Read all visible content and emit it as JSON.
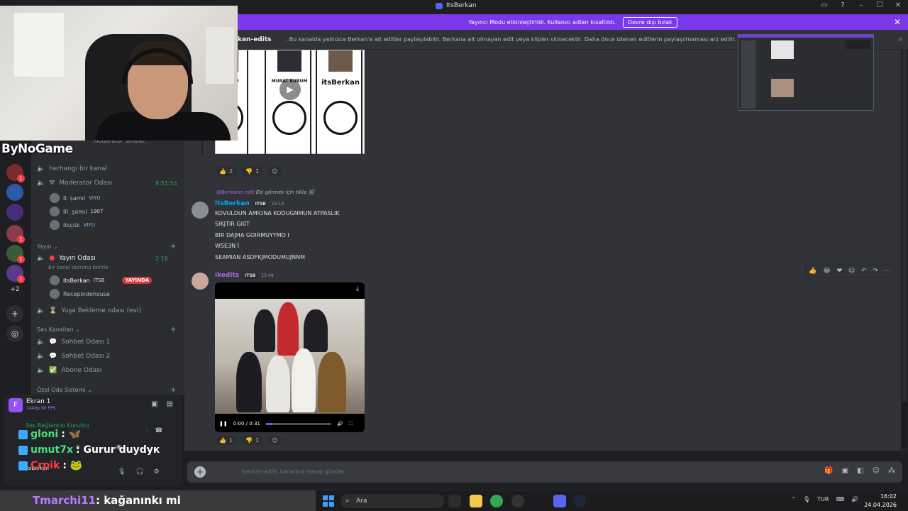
{
  "window": {
    "title": "ItsBerkan"
  },
  "banner": {
    "text": "Yayıncı Modu etkinleştirildi. Kullanıcı adları kısaltıldı.",
    "button": "Devre dışı bırak"
  },
  "header": {
    "channel": "kan-edits",
    "topic": ". Bu kanalda yalnızca Berkan'a ait editler paylaşılabilir. Berkana ait olmayan edit veya klipler silinecektir. Daha önce izlenen editlerin paylaşılmaması arz edilir."
  },
  "watermark": "ByNoGame",
  "servers": {
    "more": "+2",
    "badges": [
      "1",
      "1",
      "1",
      "1"
    ]
  },
  "sidebar": {
    "top_cut": "Moderator Sohbet",
    "channels": {
      "herhangi": "herhangi bir kanal",
      "moderator": "Moderator Odası",
      "moderator_time": "8:51:54",
      "yayin_cat": "Yayın",
      "yayin": "Yayın Odası",
      "yayin_time": "2:16",
      "yayin_status": "Bir kanal durumu belirle",
      "bekleme": "Yuşa Bekleme odası (evi)",
      "ses_cat": "Ses Kanalları",
      "sohbet1": "Sohbet Odası 1",
      "sohbet2": "Sohbet Odası 2",
      "abone": "Abone Odası",
      "ozel_cat": "Özel Oda Sistemi"
    },
    "mod_users": [
      {
        "name": "II. şamıl",
        "tag": "VIYU"
      },
      {
        "name": "III. şamıl",
        "tag": "1907"
      },
      {
        "name": "itsçük",
        "tag": "VIYU"
      }
    ],
    "yayin_users": [
      {
        "name": "itsBerkan",
        "tag": "ITSB",
        "live": "YAYINDA"
      },
      {
        "name": "Recepindehouse"
      }
    ]
  },
  "panel": {
    "screen_label": "Ekran 1",
    "screen_fps": "1440p 60 FPS",
    "voice_status": "Ses Bağlantısı Kuruldu",
    "user": "itsBerkan"
  },
  "chat": {
    "card_names": [
      "REM OĞLU",
      "MURAT KURUM",
      "itsBerkan"
    ],
    "reactions1": [
      {
        "emoji": "👍",
        "count": "2"
      },
      {
        "emoji": "👎",
        "count": "1"
      }
    ],
    "reply_name": "@Berkanın edit",
    "reply_text": "Eki görmek için tıkla",
    "msg1": {
      "author": "itsBerkan",
      "badge": "ITSB",
      "time": "15:10",
      "lines": [
        "KOVULDUN AMIONA KODUGNMUN ATPASLIK",
        "SIKJTIR GI0T",
        "BIR DAJHA GOIRMUYYMO I",
        "WSE3N İ",
        "SEAMIAN ASDFKJMODUMUJNNM"
      ]
    },
    "msg2": {
      "author": "ikedits",
      "badge": "ITSB",
      "time": "15:49",
      "video_time": "0:00 / 0:31",
      "video_progress": 0.1
    },
    "reactions2": [
      {
        "emoji": "👍",
        "count": "1"
      },
      {
        "emoji": "👎",
        "count": "1"
      }
    ],
    "composer_placeholder": "berkan-edits kanalına mesaj gönder"
  },
  "overlay": [
    {
      "name": "gloni",
      "msg": ": 🦋",
      "color": "green"
    },
    {
      "name": "umut7x",
      "msg": ": Gurur duydук",
      "color": "green"
    },
    {
      "name": "Crpik",
      "msg": ": 🐸",
      "color": "red"
    }
  ],
  "taskbar": {
    "chat_name": "Tmarchi11",
    "chat_msg": ": kağanınkı mi",
    "search": "Ara",
    "lang": "TUR",
    "time": "16:02",
    "date": "24.04.2026"
  }
}
